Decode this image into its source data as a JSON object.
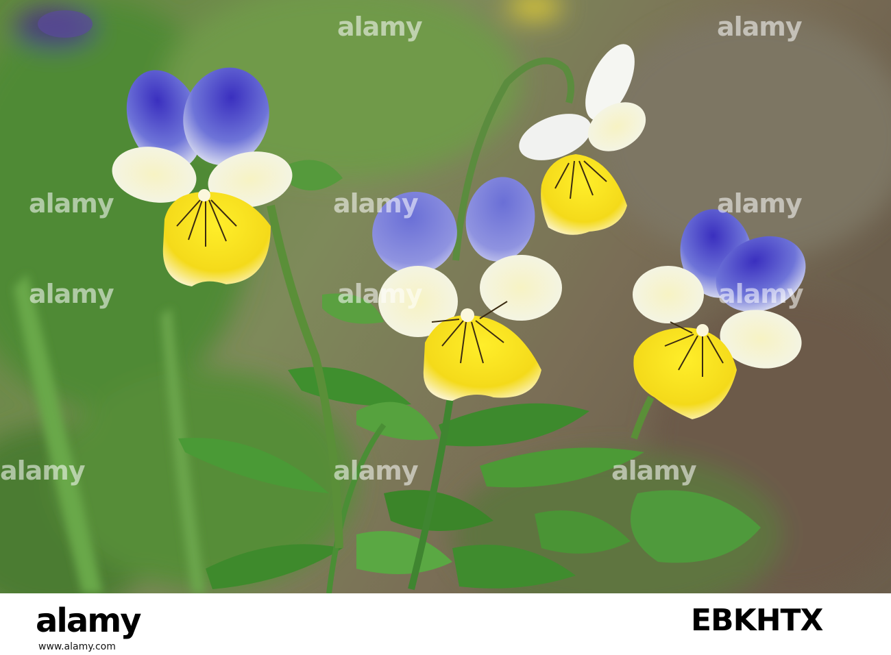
{
  "watermark": {
    "text": "alamy"
  },
  "footer": {
    "logo": "alamy",
    "image_id": "EBKHTX",
    "site": "www.alamy.com"
  },
  "colors": {
    "petal_blue": "#4a56c8",
    "petal_white": "#f2f2ec",
    "petal_yellow": "#f7e21c",
    "leaf_green": "#3f8f2e",
    "background": "#6e6a52"
  }
}
